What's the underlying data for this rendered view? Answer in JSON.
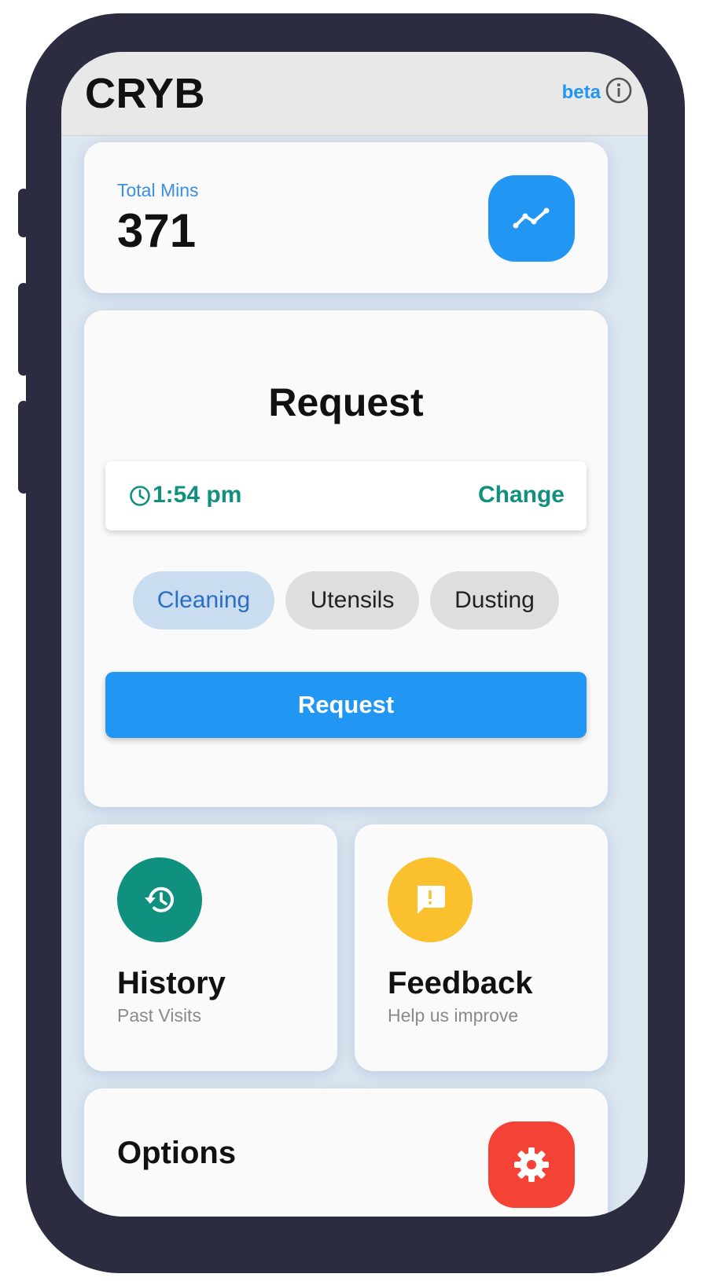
{
  "header": {
    "brand": "CRYB",
    "beta_label": "beta"
  },
  "stats": {
    "total_label": "Total Mins",
    "total_value": "371"
  },
  "request": {
    "title": "Request",
    "time": "1:54 pm",
    "change_label": "Change",
    "chips": [
      {
        "label": "Cleaning",
        "selected": true
      },
      {
        "label": "Utensils",
        "selected": false
      },
      {
        "label": "Dusting",
        "selected": false
      }
    ],
    "button_label": "Request"
  },
  "history": {
    "title": "History",
    "subtitle": "Past Visits"
  },
  "feedback": {
    "title": "Feedback",
    "subtitle": "Help us improve"
  },
  "options": {
    "title": "Options"
  },
  "colors": {
    "primary": "#2196f3",
    "teal": "#10907e",
    "amber": "#fbc02d",
    "red": "#f44336",
    "frame": "#2c2c40"
  }
}
